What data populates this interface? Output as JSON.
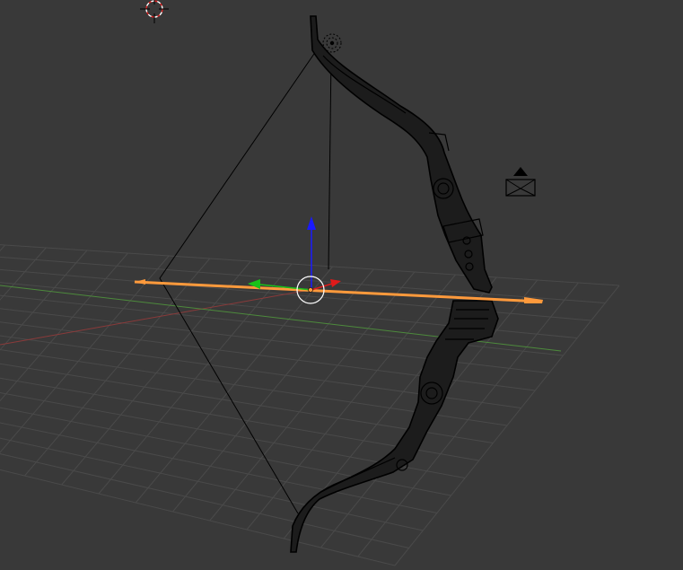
{
  "viewport": {
    "view": "3d-viewport",
    "background_color": "#393939"
  },
  "grid": {
    "line_color": "#4a4a4a",
    "x_axis_color": "#8a3a3a",
    "y_axis_color": "#4d8a3c"
  },
  "selected_object": {
    "type": "arrow",
    "outline_color": "#ff9a3c"
  },
  "manipulator": {
    "z_color": "#1a1aff",
    "y_color": "#19c219",
    "x_color": "#e01a1a"
  },
  "icons": {
    "cursor": "3d-cursor-icon",
    "lamp": "lamp-icon",
    "camera": "camera-icon"
  }
}
